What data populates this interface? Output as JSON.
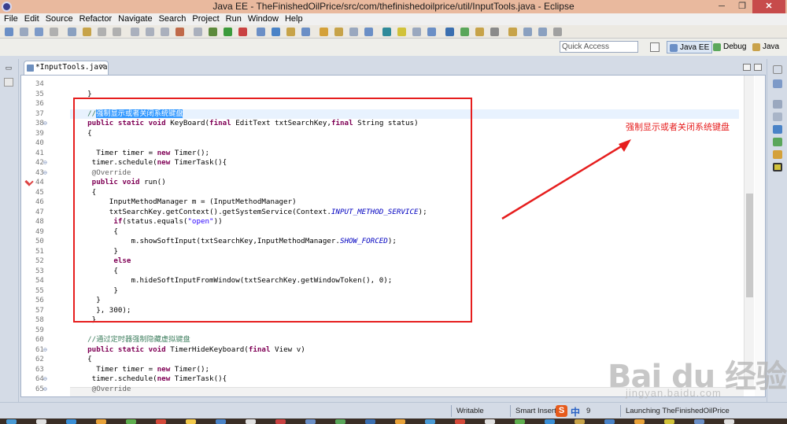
{
  "window": {
    "title": "Java EE - TheFinishedOilPrice/src/com/thefinishedoilprice/util/InputTools.java - Eclipse",
    "minimize": "─",
    "maximize": "❐",
    "close": "✕"
  },
  "menu": [
    "File",
    "Edit",
    "Source",
    "Refactor",
    "Navigate",
    "Search",
    "Project",
    "Run",
    "Window",
    "Help"
  ],
  "toolbar": {
    "quick_access_placeholder": "Quick Access",
    "perspectives": [
      {
        "label": "Java EE",
        "icon": "java-ee-perspective-icon",
        "active": true
      },
      {
        "label": "Debug",
        "icon": "debug-perspective-icon",
        "active": false
      },
      {
        "label": "Java",
        "icon": "java-perspective-icon",
        "active": false
      }
    ]
  },
  "editor": {
    "tab_label": "*InputTools.java",
    "tab_close": "✕",
    "lines": [
      {
        "n": "34",
        "fold": false,
        "err": false,
        "hl": false,
        "segs": [
          {
            "t": ""
          }
        ]
      },
      {
        "n": "35",
        "fold": false,
        "err": false,
        "hl": false,
        "segs": [
          {
            "t": "    }"
          }
        ]
      },
      {
        "n": "36",
        "fold": false,
        "err": false,
        "hl": false,
        "segs": [
          {
            "t": ""
          }
        ]
      },
      {
        "n": "37",
        "fold": false,
        "err": false,
        "hl": true,
        "segs": [
          {
            "t": "    //",
            "c": "cm"
          },
          {
            "t": "强制显示或者关闭系统键盘",
            "c": "sel"
          }
        ]
      },
      {
        "n": "38",
        "fold": true,
        "err": false,
        "hl": false,
        "segs": [
          {
            "t": "    "
          },
          {
            "t": "public static void",
            "c": "kw"
          },
          {
            "t": " KeyBoard("
          },
          {
            "t": "final",
            "c": "kw"
          },
          {
            "t": " EditText txtSearchKey,"
          },
          {
            "t": "final",
            "c": "kw"
          },
          {
            "t": " String status)"
          }
        ]
      },
      {
        "n": "39",
        "fold": false,
        "err": false,
        "hl": false,
        "segs": [
          {
            "t": "    {"
          }
        ]
      },
      {
        "n": "40",
        "fold": false,
        "err": false,
        "hl": false,
        "segs": [
          {
            "t": ""
          }
        ]
      },
      {
        "n": "41",
        "fold": false,
        "err": false,
        "hl": false,
        "segs": [
          {
            "t": "      Timer timer = "
          },
          {
            "t": "new",
            "c": "kw"
          },
          {
            "t": " Timer();"
          }
        ]
      },
      {
        "n": "42",
        "fold": true,
        "err": false,
        "hl": false,
        "segs": [
          {
            "t": "     timer.schedule("
          },
          {
            "t": "new",
            "c": "kw"
          },
          {
            "t": " TimerTask(){"
          }
        ]
      },
      {
        "n": "43",
        "fold": true,
        "err": false,
        "hl": false,
        "segs": [
          {
            "t": "     "
          },
          {
            "t": "@Override",
            "c": "ann"
          }
        ]
      },
      {
        "n": "44",
        "fold": false,
        "err": true,
        "hl": false,
        "segs": [
          {
            "t": "     "
          },
          {
            "t": "public void",
            "c": "kw"
          },
          {
            "t": " run()"
          }
        ]
      },
      {
        "n": "45",
        "fold": false,
        "err": false,
        "hl": false,
        "segs": [
          {
            "t": "     {"
          }
        ]
      },
      {
        "n": "46",
        "fold": false,
        "err": false,
        "hl": false,
        "segs": [
          {
            "t": "         InputMethodManager m = (InputMethodManager)"
          }
        ]
      },
      {
        "n": "47",
        "fold": false,
        "err": false,
        "hl": false,
        "segs": [
          {
            "t": "         txtSearchKey.getContext().getSystemService(Context."
          },
          {
            "t": "INPUT_METHOD_SERVICE",
            "c": "fld"
          },
          {
            "t": ");"
          }
        ]
      },
      {
        "n": "48",
        "fold": false,
        "err": false,
        "hl": false,
        "segs": [
          {
            "t": "          "
          },
          {
            "t": "if",
            "c": "kw"
          },
          {
            "t": "(status.equals("
          },
          {
            "t": "\"open\"",
            "c": "st"
          },
          {
            "t": "))"
          }
        ]
      },
      {
        "n": "49",
        "fold": false,
        "err": false,
        "hl": false,
        "segs": [
          {
            "t": "          {"
          }
        ]
      },
      {
        "n": "50",
        "fold": false,
        "err": false,
        "hl": false,
        "segs": [
          {
            "t": "              m.showSoftInput(txtSearchKey,InputMethodManager."
          },
          {
            "t": "SHOW_FORCED",
            "c": "fld"
          },
          {
            "t": ");"
          }
        ]
      },
      {
        "n": "51",
        "fold": false,
        "err": false,
        "hl": false,
        "segs": [
          {
            "t": "          }"
          }
        ]
      },
      {
        "n": "52",
        "fold": false,
        "err": false,
        "hl": false,
        "segs": [
          {
            "t": "          "
          },
          {
            "t": "else",
            "c": "kw"
          }
        ]
      },
      {
        "n": "53",
        "fold": false,
        "err": false,
        "hl": false,
        "segs": [
          {
            "t": "          {"
          }
        ]
      },
      {
        "n": "54",
        "fold": false,
        "err": false,
        "hl": false,
        "segs": [
          {
            "t": "              m.hideSoftInputFromWindow(txtSearchKey.getWindowToken(), 0);"
          }
        ]
      },
      {
        "n": "55",
        "fold": false,
        "err": false,
        "hl": false,
        "segs": [
          {
            "t": "          }"
          }
        ]
      },
      {
        "n": "56",
        "fold": false,
        "err": false,
        "hl": false,
        "segs": [
          {
            "t": "      }"
          }
        ]
      },
      {
        "n": "57",
        "fold": false,
        "err": false,
        "hl": false,
        "segs": [
          {
            "t": "      }, 300);"
          }
        ]
      },
      {
        "n": "58",
        "fold": false,
        "err": false,
        "hl": false,
        "segs": [
          {
            "t": "     }"
          }
        ]
      },
      {
        "n": "59",
        "fold": false,
        "err": false,
        "hl": false,
        "segs": [
          {
            "t": ""
          }
        ]
      },
      {
        "n": "60",
        "fold": false,
        "err": false,
        "hl": false,
        "segs": [
          {
            "t": "    //",
            "c": "cm"
          },
          {
            "t": "通过定时器强制隐藏虚拟键盘",
            "c": "cm"
          }
        ]
      },
      {
        "n": "61",
        "fold": true,
        "err": false,
        "hl": false,
        "segs": [
          {
            "t": "    "
          },
          {
            "t": "public static void",
            "c": "kw"
          },
          {
            "t": " TimerHideKeyboard("
          },
          {
            "t": "final",
            "c": "kw"
          },
          {
            "t": " View v)"
          }
        ]
      },
      {
        "n": "62",
        "fold": false,
        "err": false,
        "hl": false,
        "segs": [
          {
            "t": "    {"
          }
        ]
      },
      {
        "n": "63",
        "fold": false,
        "err": false,
        "hl": false,
        "segs": [
          {
            "t": "      Timer timer = "
          },
          {
            "t": "new",
            "c": "kw"
          },
          {
            "t": " Timer();"
          }
        ]
      },
      {
        "n": "64",
        "fold": true,
        "err": false,
        "hl": false,
        "segs": [
          {
            "t": "     timer.schedule("
          },
          {
            "t": "new",
            "c": "kw"
          },
          {
            "t": " TimerTask(){"
          }
        ]
      },
      {
        "n": "65",
        "fold": true,
        "err": false,
        "hl": false,
        "segs": [
          {
            "t": "     "
          },
          {
            "t": "@Override",
            "c": "ann"
          }
        ]
      }
    ]
  },
  "annotation": {
    "text": "强制显示或者关闭系统键盘",
    "color": "#e61e1e"
  },
  "status": {
    "writable": "Writable",
    "insert_mode": "Smart Insert",
    "ime_icon": "S",
    "ime_mode": "中",
    "position_fragment": "9",
    "launching": "Launching TheFinishedOilPrice"
  },
  "watermark": {
    "main": "Bai du 经验",
    "sub": "jingyan.baidu.com"
  }
}
